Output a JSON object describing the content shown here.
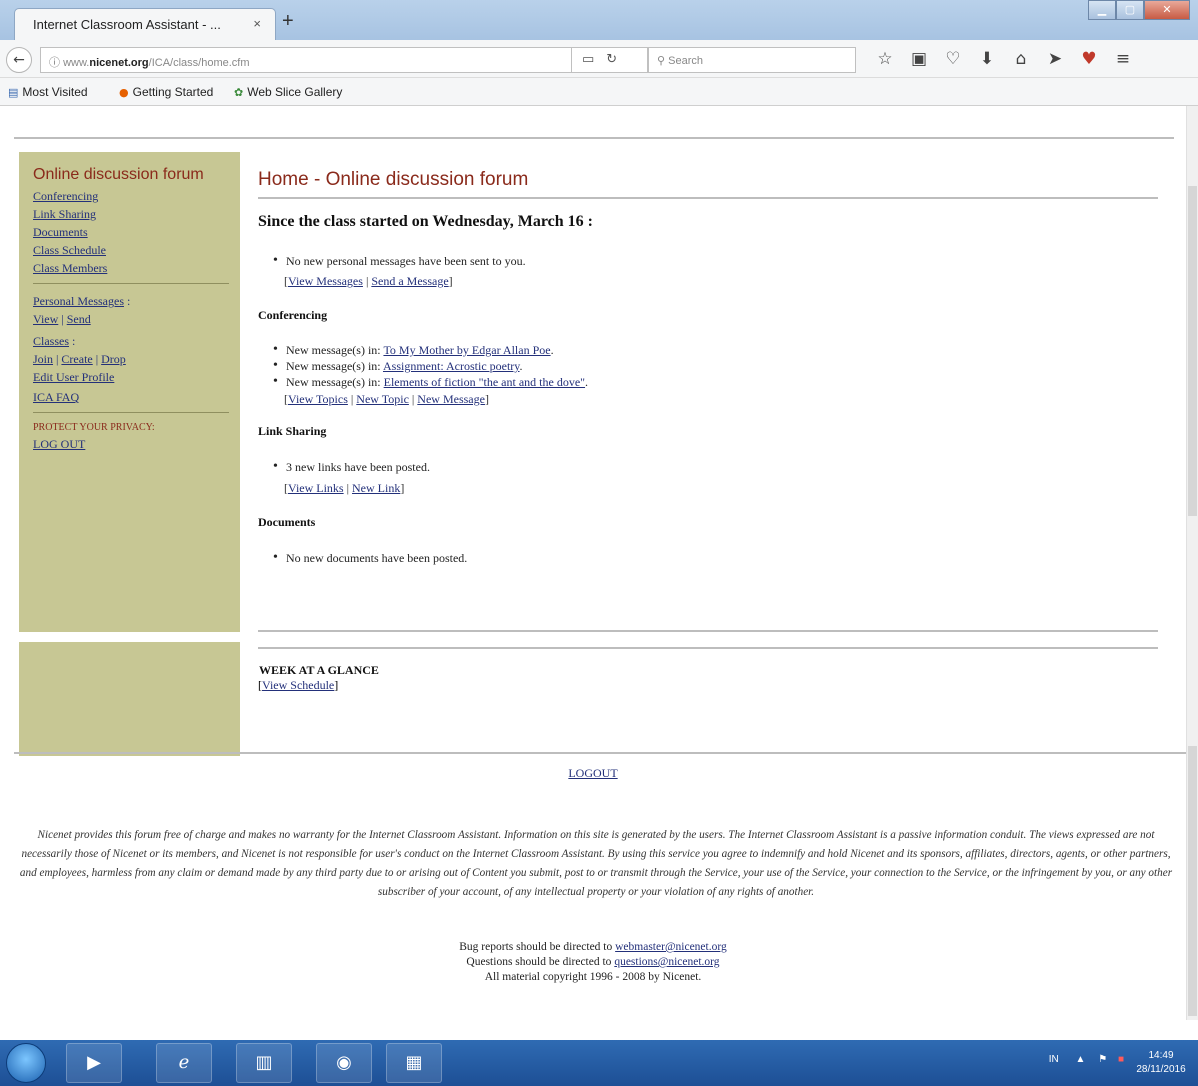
{
  "browser": {
    "tab_title": "Internet Classroom Assistant - ...",
    "tab_close": "×",
    "new_tab": "+",
    "url_prefix": "www.",
    "url_domain": "nicenet.org",
    "url_path": "/ICA/class/home.cfm",
    "search_placeholder": "Search",
    "bookmarks": [
      "Most Visited",
      "Getting Started",
      "Web Slice Gallery"
    ]
  },
  "sidebar": {
    "heading": "Online discussion forum",
    "primary_links": [
      "Conferencing",
      "Link Sharing",
      "Documents",
      "Class Schedule",
      "Class Members"
    ],
    "personal_messages_label": "Personal Messages",
    "personal_messages_colon": " :",
    "pm_view": "View",
    "pm_send": "Send",
    "classes_label": "Classes",
    "classes_colon": " :",
    "classes_join": "Join",
    "classes_create": "Create",
    "classes_drop": "Drop",
    "edit_profile": "Edit User Profile",
    "ica_faq": "ICA FAQ",
    "privacy_warning": "PROTECT YOUR PRIVACY:",
    "logout": "LOG OUT"
  },
  "main": {
    "title": "Home - Online discussion forum",
    "since_heading": "Since the class started on Wednesday, March 16 :",
    "personal": {
      "status": "No new personal messages have been sent to you.",
      "view_messages": "View Messages",
      "send_message": "Send a Message"
    },
    "conferencing": {
      "title": "Conferencing",
      "prefix": "New message(s) in: ",
      "topics": [
        "To My Mother by Edgar Allan Poe",
        "Assignment: Acrostic poetry",
        "Elements of fiction \"the ant and the dove\""
      ],
      "view_topics": "View Topics",
      "new_topic": "New Topic",
      "new_message": "New Message"
    },
    "link_sharing": {
      "title": "Link Sharing",
      "status": "3 new links have been posted.",
      "view_links": "View Links",
      "new_link": "New Link"
    },
    "documents": {
      "title": "Documents",
      "status": "No new documents have been posted."
    },
    "week": {
      "title": "WEEK AT A GLANCE",
      "view_schedule": "View Schedule"
    }
  },
  "footer": {
    "logout": "LOGOUT",
    "disclaimer": "Nicenet provides this forum free of charge and makes no warranty for the Internet Classroom Assistant. Information on this site is generated by the users. The Internet Classroom Assistant is a passive information conduit. The views expressed are not necessarily those of Nicenet or its members, and Nicenet is not responsible for user's conduct on the Internet Classroom Assistant. By using this service you agree to indemnify and hold Nicenet and its sponsors, affiliates, directors, agents, or other partners, and employees, harmless from any claim or demand made by any third party due to or arising out of Content you submit, post to or transmit through the Service, your use of the Service, your connection to the Service, or the infringement by you, or any other subscriber of your account, of any intellectual property or your violation of any rights of another.",
    "bug_prefix": "Bug reports should be directed to ",
    "bug_email": "webmaster@nicenet.org",
    "questions_prefix": "Questions should be directed to ",
    "questions_email": "questions@nicenet.org",
    "copyright": "All material copyright 1996 - 2008 by Nicenet."
  },
  "taskbar": {
    "lang": "IN",
    "time": "14:49",
    "date": "28/11/2016"
  },
  "icons": {
    "back": "back-arrow-icon",
    "bookmark_star": "star-icon",
    "home": "home-icon",
    "download": "download-arrow-icon",
    "menu": "hamburger-menu-icon"
  },
  "colors": {
    "sidebar_bg": "#c7c794",
    "heading_red": "#8a2a1b",
    "link_blue": "#23307a"
  }
}
